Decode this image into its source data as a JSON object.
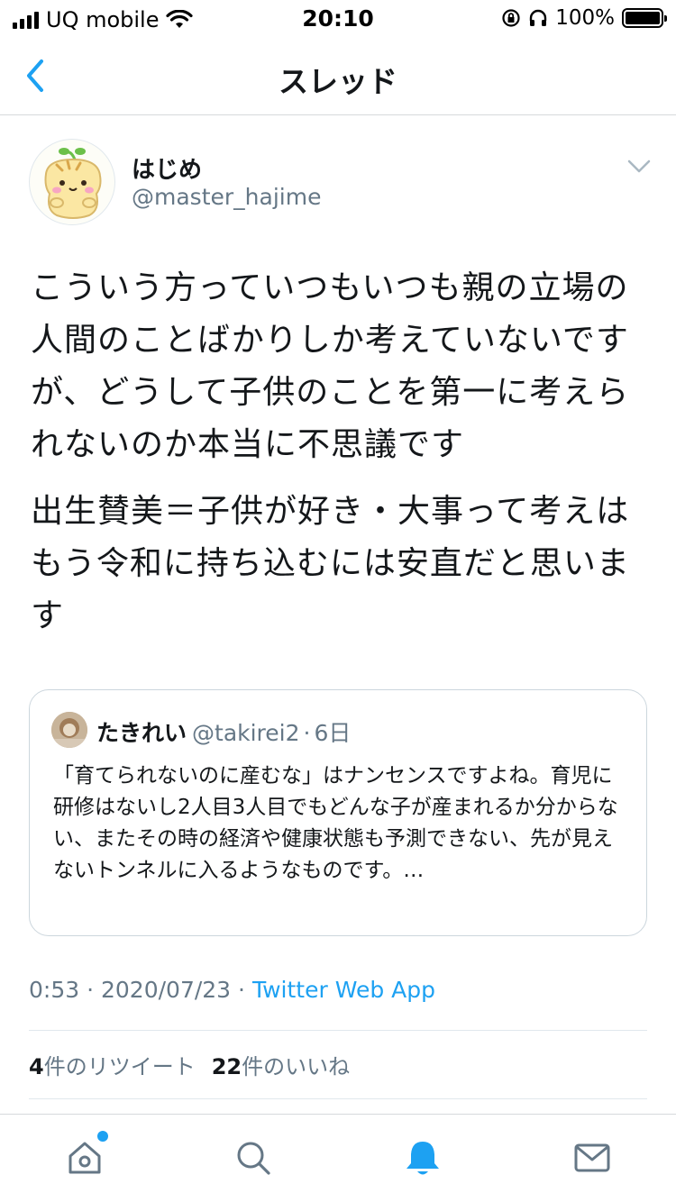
{
  "status_bar": {
    "carrier": "UQ mobile",
    "time": "20:10",
    "battery": "100%"
  },
  "nav": {
    "title": "スレッド"
  },
  "tweet": {
    "display_name": "はじめ",
    "handle": "@master_hajime",
    "paragraphs": [
      "こういう方っていつもいつも親の立場の人間のことばかりしか考えていないですが、どうして子供のことを第一に考えられないのか本当に不思議です",
      "出生賛美＝子供が好き・大事って考えはもう令和に持ち込むには安直だと思います"
    ],
    "time": "0:53",
    "date": "2020/07/23",
    "source": "Twitter Web App",
    "retweet_count": "4",
    "retweet_label": "件のリツイート",
    "like_count": "22",
    "like_label": "件のいいね"
  },
  "quote": {
    "name": "たきれい",
    "handle": "@takirei2",
    "age": "6日",
    "text": "「育てられないのに産むな」はナンセンスですよね。育児に研修はないし2人目3人目でもどんな子が産まれるか分からない、またその時の経済や健康状態も予測できない、先が見えないトンネルに入るようなものです。…"
  },
  "tab_bar": {
    "items": [
      "home-icon",
      "search-icon",
      "notifications-icon",
      "messages-icon"
    ],
    "active": "notifications-icon"
  },
  "colors": {
    "accent": "#1da1f2",
    "text": "#14171a",
    "secondary": "#657786",
    "border": "#e1e8ed"
  }
}
